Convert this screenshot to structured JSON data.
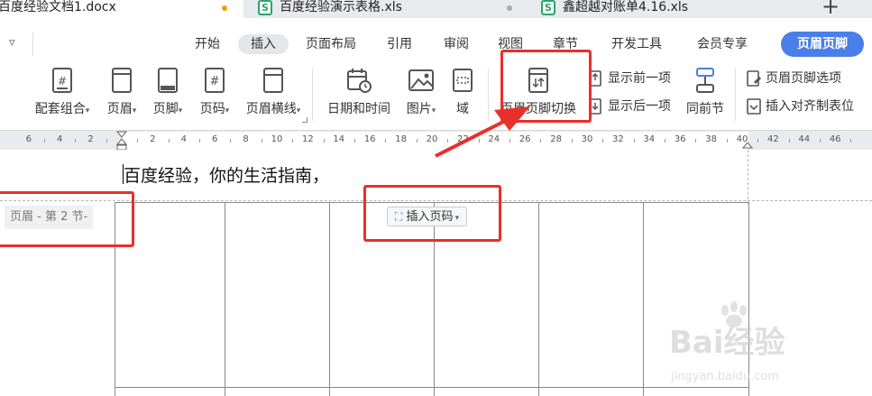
{
  "tabs": [
    {
      "title": "百度经验文档1.docx",
      "active": true
    },
    {
      "title": "百度经验演示表格.xls",
      "active": false
    },
    {
      "title": "鑫超越对账单4.16.xls",
      "active": false
    }
  ],
  "colors": {
    "accent": "#4a7ee8",
    "annotation": "#e8302a",
    "modified_dot": "#f39c12"
  },
  "menu": {
    "collapse_icon": "▿",
    "items": [
      "开始",
      "插入",
      "页面布局",
      "引用",
      "审阅",
      "视图",
      "章节",
      "开发工具",
      "会员专享"
    ],
    "active_item": "插入",
    "context_tab": "页眉页脚"
  },
  "ribbon": {
    "buttons": {
      "set": "配套组合",
      "header": "页眉",
      "footer": "页脚",
      "page_number": "页码",
      "header_line": "页眉横线",
      "datetime": "日期和时间",
      "picture": "图片",
      "field": "域",
      "switch": "页眉页脚切换",
      "show_prev": "显示前一项",
      "show_next": "显示后一项",
      "same_as_prev": "同前节",
      "options": "页眉页脚选项",
      "align_tab": "插入对齐制表位"
    }
  },
  "ruler": {
    "left_labels": [
      "6",
      "4",
      "2"
    ],
    "right_labels": [
      "2",
      "4",
      "6",
      "8",
      "10",
      "12",
      "14",
      "16",
      "18",
      "20",
      "22",
      "24",
      "26",
      "28",
      "30",
      "32",
      "34",
      "36",
      "38",
      "40",
      "42",
      "44",
      "46"
    ]
  },
  "document": {
    "body_text": "百度经验，你的生活指南，",
    "header_label": "页眉  - 第 2 节-",
    "insert_page_number": "插入页码"
  },
  "watermark": {
    "brand": "Bai经验",
    "url": "jingyan.baidu.com"
  }
}
